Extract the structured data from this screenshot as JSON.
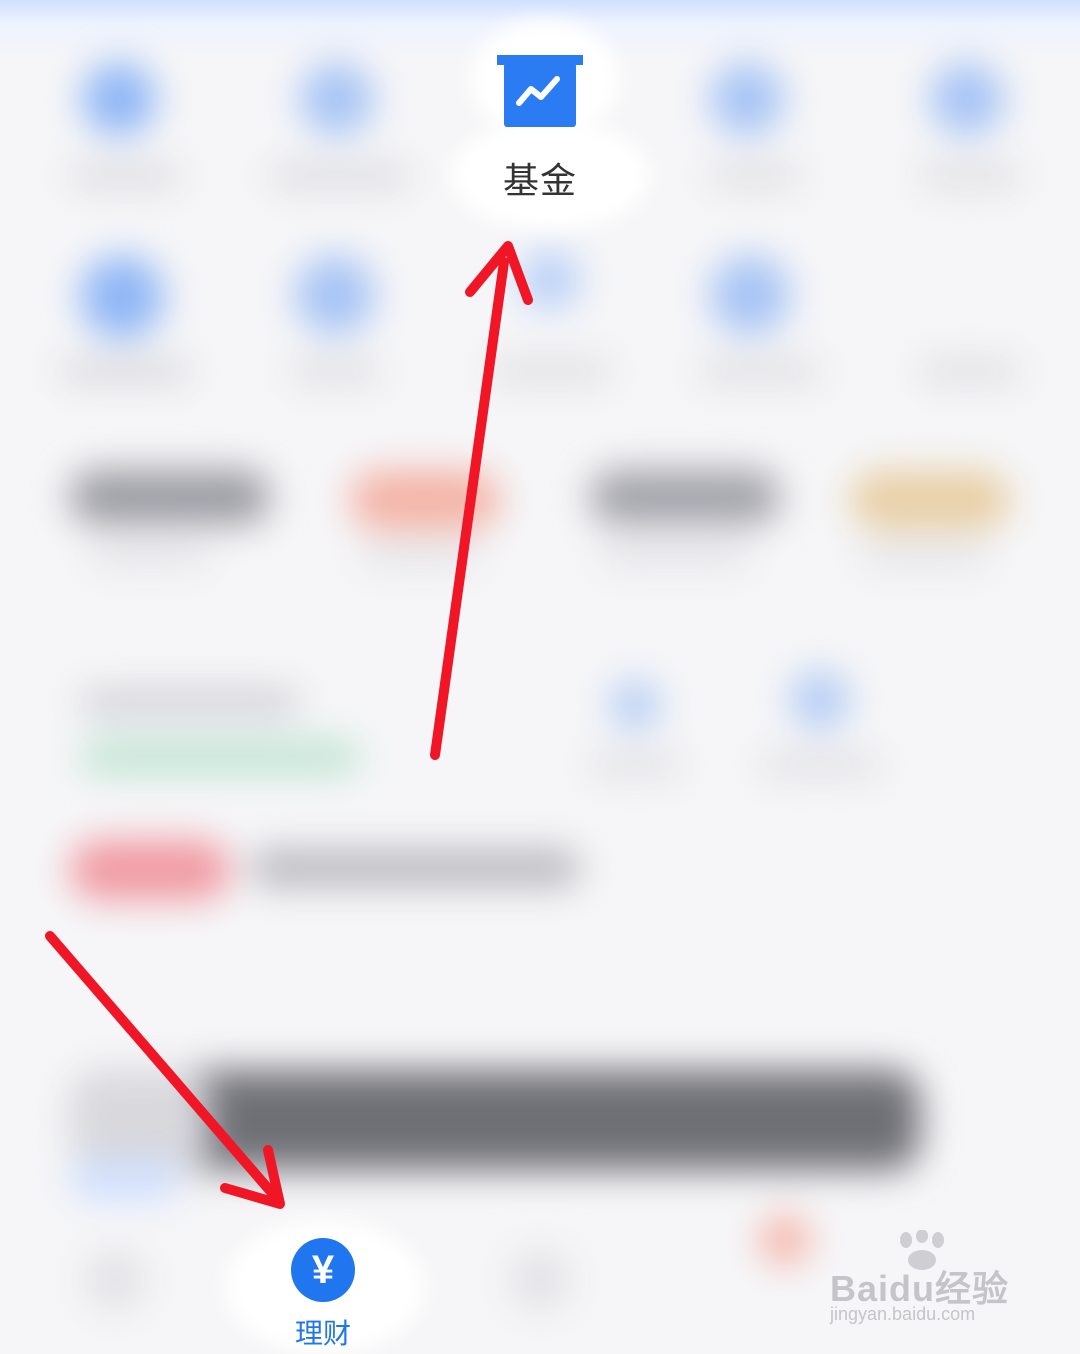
{
  "highlighted_items": {
    "fund": {
      "label": "基金",
      "icon": "fund-chart-icon"
    },
    "wealth_tab": {
      "label": "理财",
      "icon": "yuan-icon"
    }
  },
  "annotations": {
    "arrow_color": "#f01626"
  },
  "watermark": {
    "brand": "Baidu经验",
    "url": "jingyan.baidu.com"
  },
  "colors": {
    "accent_blue": "#1f76ef",
    "fund_icon_blue": "#2b7cf2",
    "annotation_red": "#f01626"
  }
}
